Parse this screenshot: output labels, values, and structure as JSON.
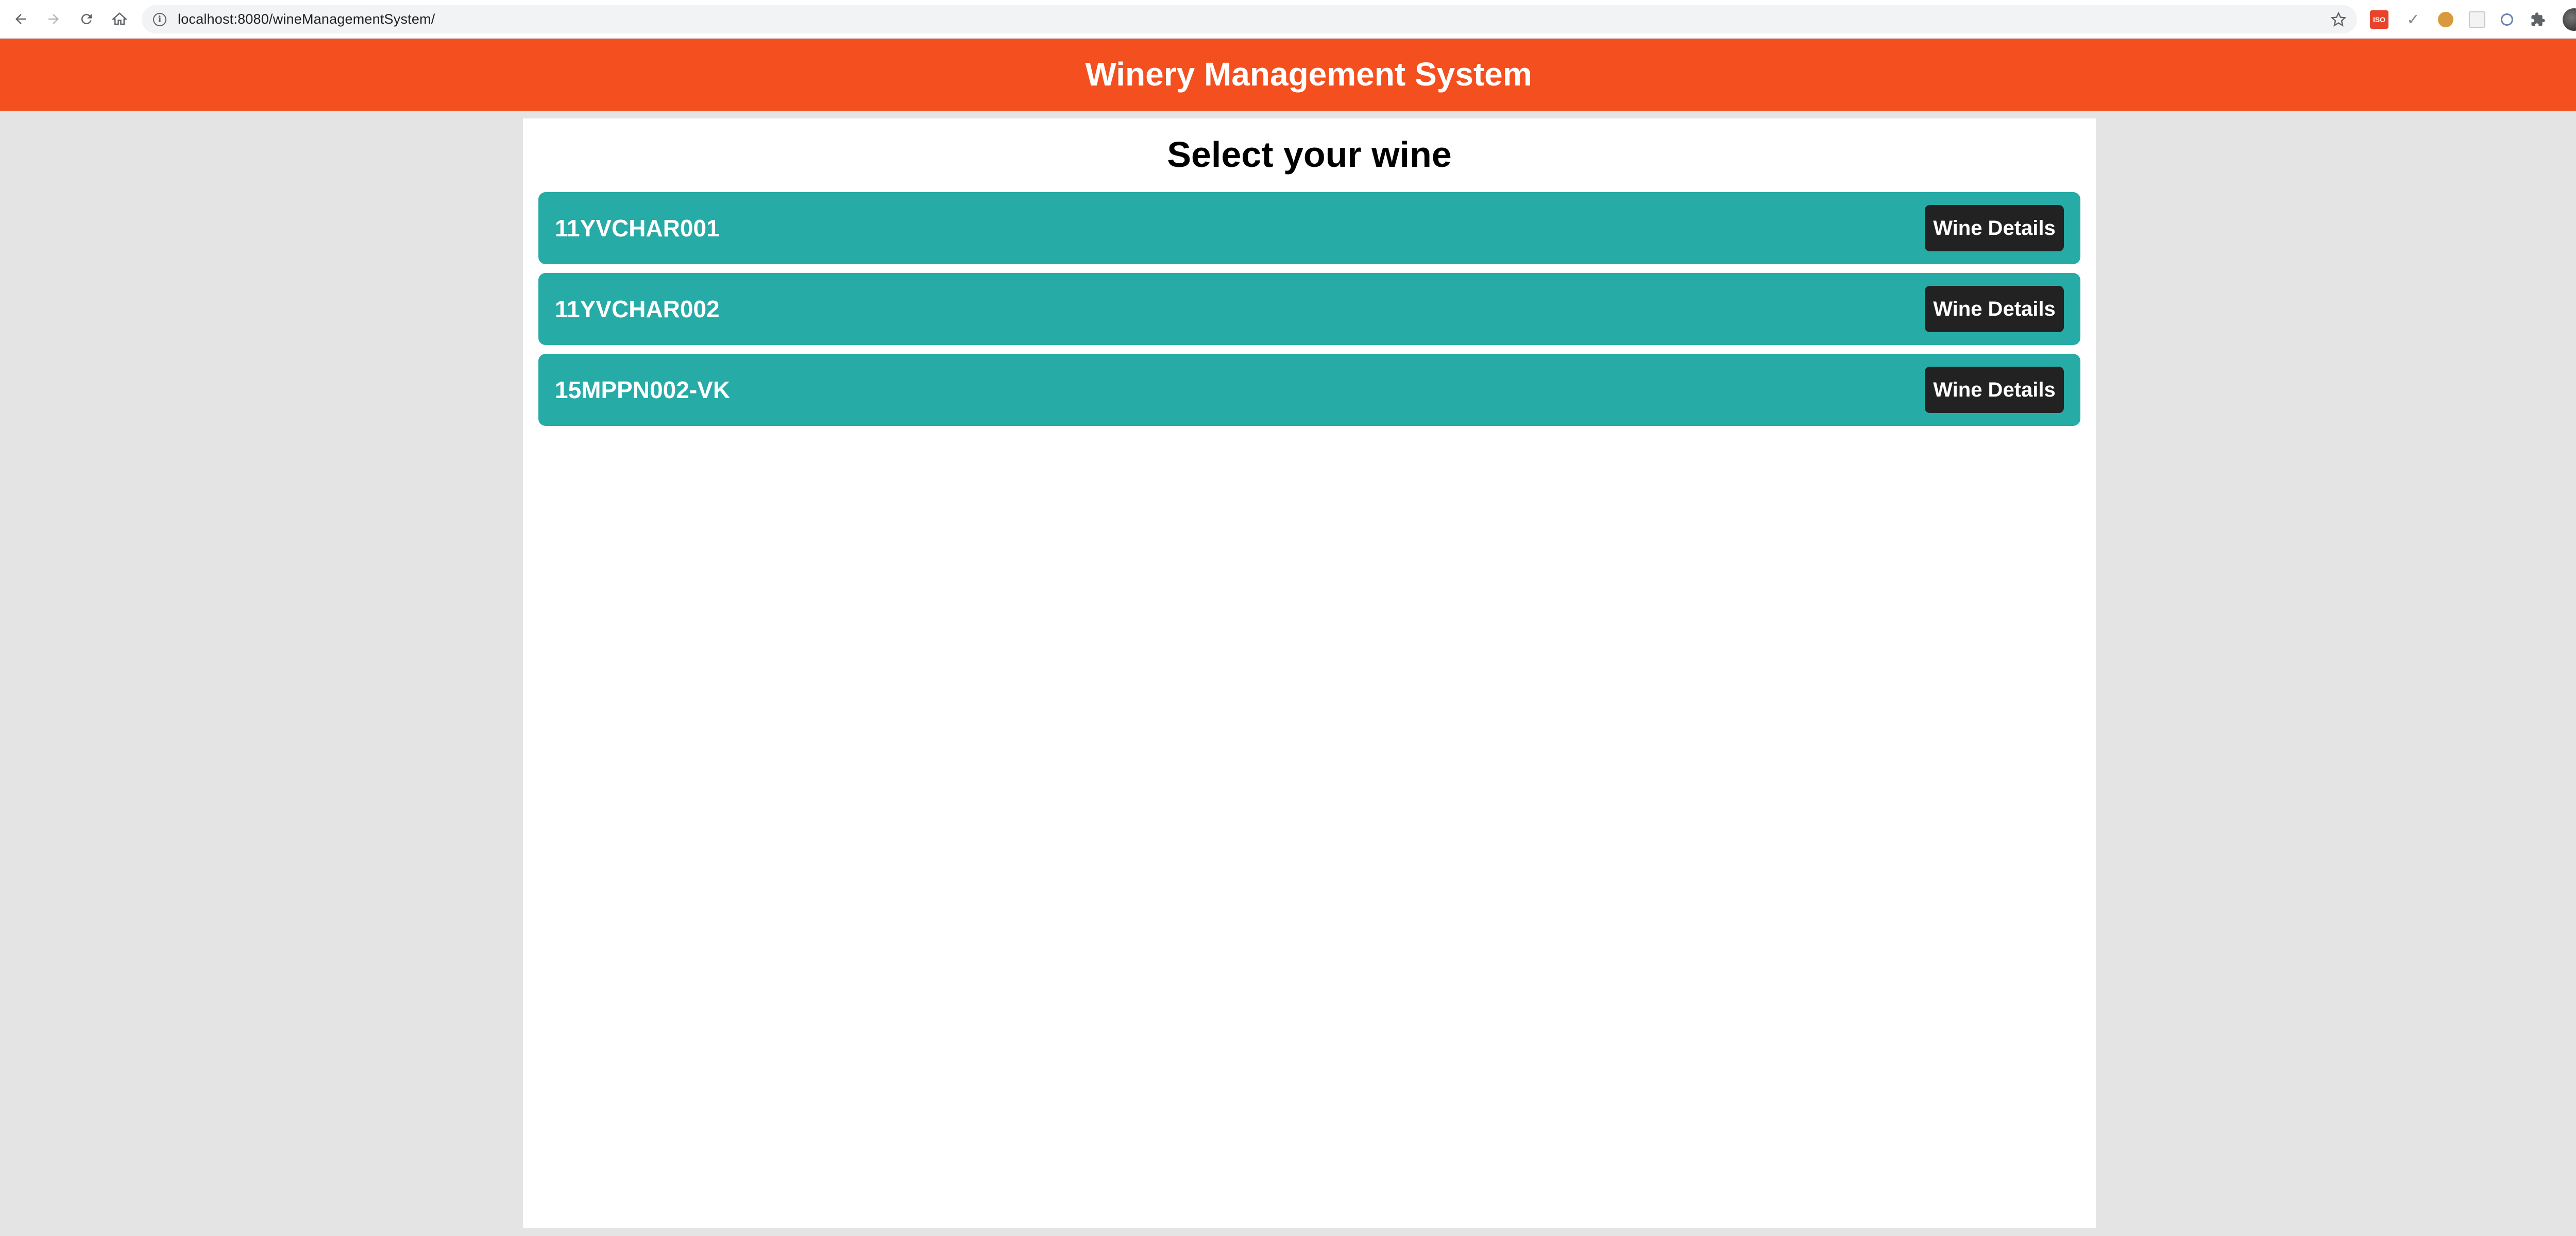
{
  "browser": {
    "url": "localhost:8080/wineManagementSystem/",
    "icons": {
      "back": "back-arrow-icon",
      "forward": "forward-arrow-icon",
      "reload": "reload-icon",
      "home": "home-icon",
      "site_info": "info-icon",
      "bookmark": "star-icon",
      "extensions": "puzzle-icon",
      "menu": "kebab-menu-icon"
    },
    "extension_iso_label": "ISO"
  },
  "header": {
    "title": "Winery Management System",
    "color": "#f44f1f"
  },
  "main": {
    "title": "Select your wine",
    "row_color": "#26aba6",
    "button_color": "#222222",
    "wines": [
      {
        "name": "11YVCHAR001",
        "button_label": "Wine Details"
      },
      {
        "name": "11YVCHAR002",
        "button_label": "Wine Details"
      },
      {
        "name": "15MPPN002-VK",
        "button_label": "Wine Details"
      }
    ]
  }
}
